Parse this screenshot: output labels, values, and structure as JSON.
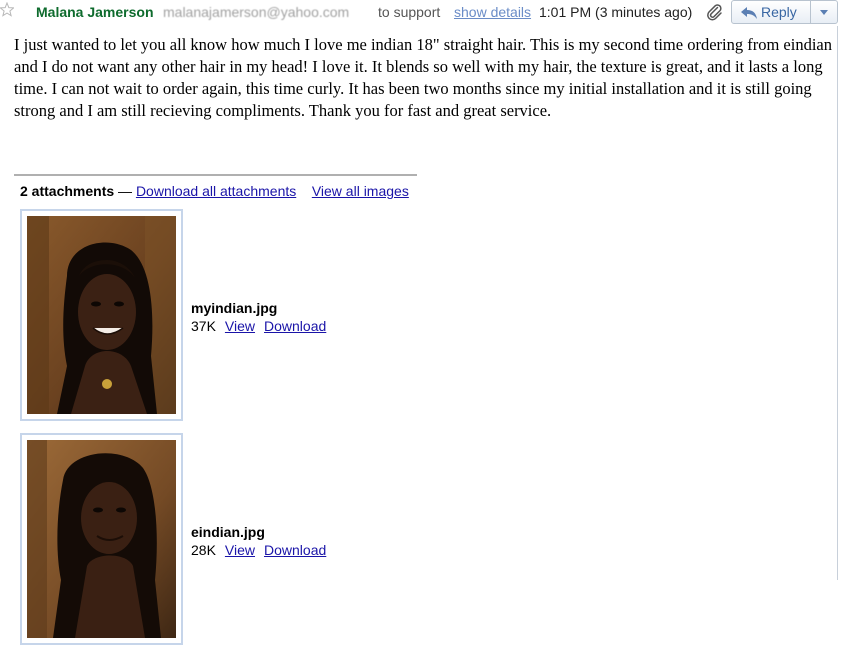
{
  "header": {
    "sender_name": "Malana Jamerson",
    "sender_email": "malanajamerson@yahoo.com",
    "recipient_text": "to support",
    "show_details": "show details",
    "time": "1:01 PM (3 minutes ago)",
    "reply_label": "Reply"
  },
  "message": {
    "body": "I just wanted to let you all know how much I love me indian 18\" straight hair. This is my second time ordering from eindian and I do not want any other hair in my head! I love it. It blends so well with my hair, the texture is great, and it lasts a long time. I can not wait to order again, this time curly. It has been two months since my initial installation and it is still going strong and I am still recieving compliments. Thank you for fast and great service."
  },
  "attachments": {
    "count_label": "2 attachments",
    "separator": " — ",
    "download_all": "Download all attachments",
    "view_all_images": "View all images",
    "items": [
      {
        "name": "myindian.jpg",
        "size": "37K",
        "view": "View",
        "download": "Download"
      },
      {
        "name": "eindian.jpg",
        "size": "28K",
        "view": "View",
        "download": "Download"
      }
    ]
  },
  "colors": {
    "sender": "#0e6b2d",
    "link": "#1a14a8",
    "show_details": "#6a8cc7",
    "reply_text": "#3866a3",
    "thumb_border": "#c6d5ea"
  },
  "icons": {
    "star": "star-outline-icon",
    "attachment": "paperclip-icon",
    "reply": "reply-arrow-icon",
    "dropdown": "chevron-down-icon"
  }
}
